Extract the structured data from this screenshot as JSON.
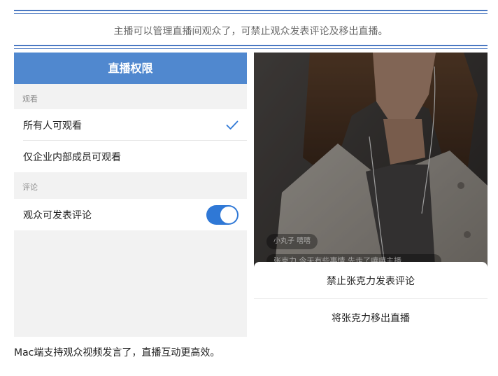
{
  "caption": "主播可以管理直播间观众了，可禁止观众发表评论及移出直播。",
  "permissions": {
    "title": "直播权限",
    "watch_section": "观看",
    "watch_options": [
      {
        "label": "所有人可观看",
        "selected": true
      },
      {
        "label": "仅企业内部成员可观看",
        "selected": false
      }
    ],
    "comment_section": "评论",
    "comment_toggle": {
      "label": "观众可发表评论",
      "on": true
    }
  },
  "live_preview": {
    "chat_user": "小丸子 嘻嘻",
    "chat_message": "张克力 今天有些事情 先走了嘻嘻主播",
    "sheet_actions": [
      "禁止张克力发表评论",
      "将张克力移出直播"
    ]
  },
  "footer": "Mac端支持观众视频发言了，直播互动更高效。",
  "colors": {
    "rule": "#4a78c2",
    "nav_bar": "#5088cf",
    "toggle_on": "#2f78d6",
    "check": "#2f78d6"
  }
}
